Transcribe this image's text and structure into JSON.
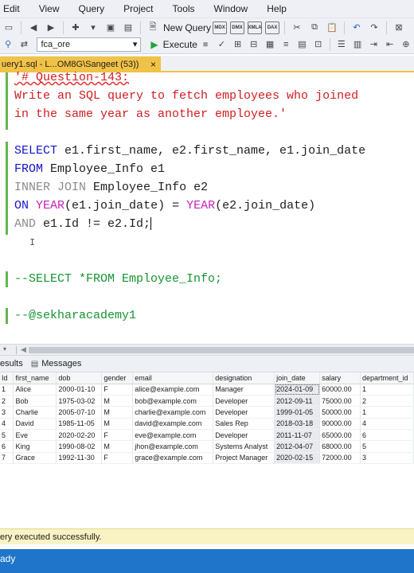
{
  "menu": [
    "Edit",
    "View",
    "Query",
    "Project",
    "Tools",
    "Window",
    "Help"
  ],
  "toolbar1": {
    "new_query_label": "New Query",
    "badges": [
      "MDX",
      "DMX",
      "XMLA",
      "DAX"
    ]
  },
  "toolbar2": {
    "database": "fca_ore",
    "execute_label": "Execute"
  },
  "tab": {
    "title": "uery1.sql - L...OM8G\\Sangeet (53))",
    "close": "×"
  },
  "editor": {
    "comment_line1": "'# Question-143:",
    "comment_line2": "Write an SQL query to fetch employees who joined",
    "comment_line3": "in the same year as another employee.'",
    "l1_kw": "SELECT",
    "l1_rest": " e1.first_name, e2.first_name, e1.join_date",
    "l2_kw": "FROM",
    "l2_rest": " Employee_Info e1",
    "l3_kw1": "INNER",
    "l3_kw2": "JOIN",
    "l3_rest": " Employee_Info e2",
    "l4_kw": "ON",
    "l4_fn1": "YEAR",
    "l4_a": "(e1.join_date) = ",
    "l4_fn2": "YEAR",
    "l4_b": "(e2.join_date)",
    "l5_kw": "AND",
    "l5_rest": " e1.Id != e2.Id;",
    "comment_select": "--SELECT *FROM Employee_Info;",
    "comment_handle": "--@sekharacademy1"
  },
  "results_tabs": {
    "results": "esults",
    "messages": "Messages"
  },
  "grid": {
    "columns": [
      "Id",
      "first_name",
      "dob",
      "gender",
      "email",
      "designation",
      "join_date",
      "salary",
      "department_id"
    ],
    "rows": [
      [
        "1",
        "Alice",
        "2000-01-10",
        "F",
        "alice@example.com",
        "Manager",
        "2024-01-09",
        "60000.00",
        "1"
      ],
      [
        "2",
        "Bob",
        "1975-03-02",
        "M",
        "bob@example.com",
        "Developer",
        "2012-09-11",
        "75000.00",
        "2"
      ],
      [
        "3",
        "Charlie",
        "2005-07-10",
        "M",
        "charlie@example.com",
        "Developer",
        "1999-01-05",
        "50000.00",
        "1"
      ],
      [
        "4",
        "David",
        "1985-11-05",
        "M",
        "david@example.com",
        "Sales Rep",
        "2018-03-18",
        "90000.00",
        "4"
      ],
      [
        "5",
        "Eve",
        "2020-02-20",
        "F",
        "eve@example.com",
        "Developer",
        "2011-11-07",
        "65000.00",
        "6"
      ],
      [
        "6",
        "King",
        "1990-08-02",
        "M",
        "jhon@example.com",
        "Systems Analyst",
        "2012-04-07",
        "68000.00",
        "5"
      ],
      [
        "7",
        "Grace",
        "1992-11-30",
        "F",
        "grace@example.com",
        "Project Manager",
        "2020-02-15",
        "72000.00",
        "3"
      ]
    ]
  },
  "status_message": "ery executed successfully.",
  "status_bar": "ady"
}
